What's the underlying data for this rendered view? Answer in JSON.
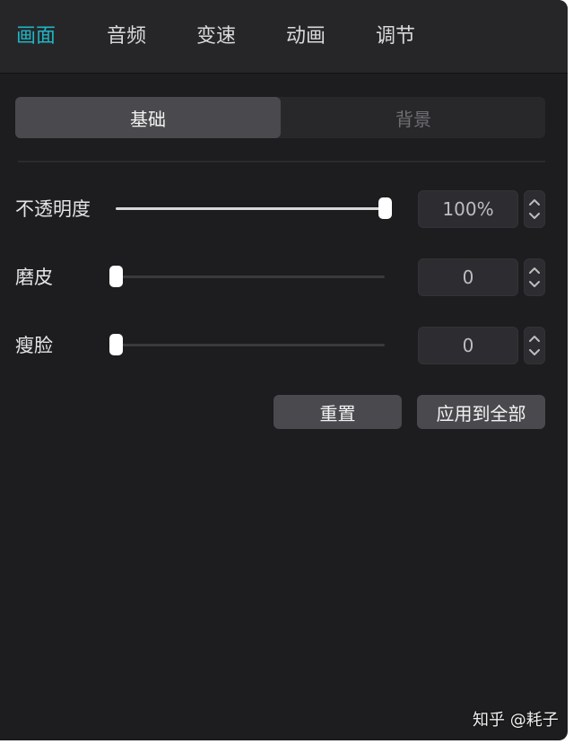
{
  "tabs": [
    {
      "label": "画面",
      "active": true
    },
    {
      "label": "音频",
      "active": false
    },
    {
      "label": "变速",
      "active": false
    },
    {
      "label": "动画",
      "active": false
    },
    {
      "label": "调节",
      "active": false
    }
  ],
  "segments": {
    "basic": "基础",
    "background": "背景",
    "selected": "基础"
  },
  "controls": [
    {
      "label": "不透明度",
      "value": "100%",
      "level": 1.0
    },
    {
      "label": "磨皮",
      "value": "0",
      "level": 0.0
    },
    {
      "label": "瘦脸",
      "value": "0",
      "level": 0.0
    }
  ],
  "actions": {
    "reset": "重置",
    "apply_all": "应用到全部"
  },
  "watermark": "知乎 @耗子",
  "colors": {
    "accent": "#1fb5c4",
    "panel_bg": "#1d1d1f",
    "tabbar_bg": "#262629",
    "button_bg": "#4a4a4e"
  }
}
